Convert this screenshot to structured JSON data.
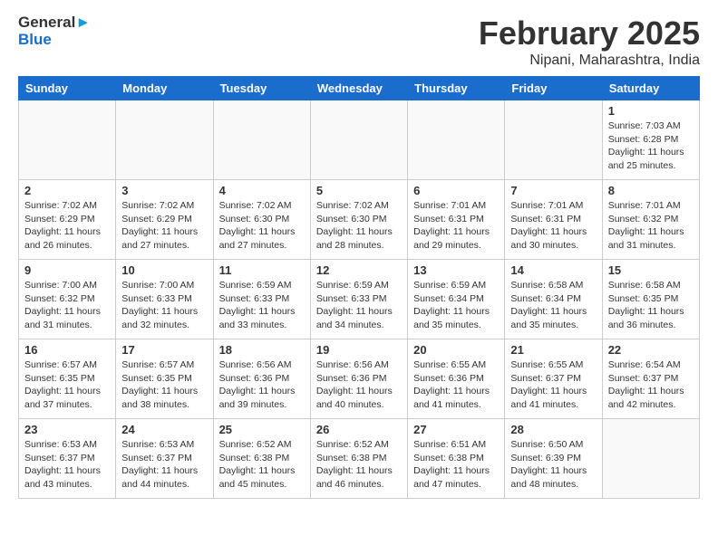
{
  "header": {
    "logo_line1": "General",
    "logo_line2": "Blue",
    "month_title": "February 2025",
    "location": "Nipani, Maharashtra, India"
  },
  "weekdays": [
    "Sunday",
    "Monday",
    "Tuesday",
    "Wednesday",
    "Thursday",
    "Friday",
    "Saturday"
  ],
  "weeks": [
    [
      {
        "day": "",
        "info": ""
      },
      {
        "day": "",
        "info": ""
      },
      {
        "day": "",
        "info": ""
      },
      {
        "day": "",
        "info": ""
      },
      {
        "day": "",
        "info": ""
      },
      {
        "day": "",
        "info": ""
      },
      {
        "day": "1",
        "info": "Sunrise: 7:03 AM\nSunset: 6:28 PM\nDaylight: 11 hours and 25 minutes."
      }
    ],
    [
      {
        "day": "2",
        "info": "Sunrise: 7:02 AM\nSunset: 6:29 PM\nDaylight: 11 hours and 26 minutes."
      },
      {
        "day": "3",
        "info": "Sunrise: 7:02 AM\nSunset: 6:29 PM\nDaylight: 11 hours and 27 minutes."
      },
      {
        "day": "4",
        "info": "Sunrise: 7:02 AM\nSunset: 6:30 PM\nDaylight: 11 hours and 27 minutes."
      },
      {
        "day": "5",
        "info": "Sunrise: 7:02 AM\nSunset: 6:30 PM\nDaylight: 11 hours and 28 minutes."
      },
      {
        "day": "6",
        "info": "Sunrise: 7:01 AM\nSunset: 6:31 PM\nDaylight: 11 hours and 29 minutes."
      },
      {
        "day": "7",
        "info": "Sunrise: 7:01 AM\nSunset: 6:31 PM\nDaylight: 11 hours and 30 minutes."
      },
      {
        "day": "8",
        "info": "Sunrise: 7:01 AM\nSunset: 6:32 PM\nDaylight: 11 hours and 31 minutes."
      }
    ],
    [
      {
        "day": "9",
        "info": "Sunrise: 7:00 AM\nSunset: 6:32 PM\nDaylight: 11 hours and 31 minutes."
      },
      {
        "day": "10",
        "info": "Sunrise: 7:00 AM\nSunset: 6:33 PM\nDaylight: 11 hours and 32 minutes."
      },
      {
        "day": "11",
        "info": "Sunrise: 6:59 AM\nSunset: 6:33 PM\nDaylight: 11 hours and 33 minutes."
      },
      {
        "day": "12",
        "info": "Sunrise: 6:59 AM\nSunset: 6:33 PM\nDaylight: 11 hours and 34 minutes."
      },
      {
        "day": "13",
        "info": "Sunrise: 6:59 AM\nSunset: 6:34 PM\nDaylight: 11 hours and 35 minutes."
      },
      {
        "day": "14",
        "info": "Sunrise: 6:58 AM\nSunset: 6:34 PM\nDaylight: 11 hours and 35 minutes."
      },
      {
        "day": "15",
        "info": "Sunrise: 6:58 AM\nSunset: 6:35 PM\nDaylight: 11 hours and 36 minutes."
      }
    ],
    [
      {
        "day": "16",
        "info": "Sunrise: 6:57 AM\nSunset: 6:35 PM\nDaylight: 11 hours and 37 minutes."
      },
      {
        "day": "17",
        "info": "Sunrise: 6:57 AM\nSunset: 6:35 PM\nDaylight: 11 hours and 38 minutes."
      },
      {
        "day": "18",
        "info": "Sunrise: 6:56 AM\nSunset: 6:36 PM\nDaylight: 11 hours and 39 minutes."
      },
      {
        "day": "19",
        "info": "Sunrise: 6:56 AM\nSunset: 6:36 PM\nDaylight: 11 hours and 40 minutes."
      },
      {
        "day": "20",
        "info": "Sunrise: 6:55 AM\nSunset: 6:36 PM\nDaylight: 11 hours and 41 minutes."
      },
      {
        "day": "21",
        "info": "Sunrise: 6:55 AM\nSunset: 6:37 PM\nDaylight: 11 hours and 41 minutes."
      },
      {
        "day": "22",
        "info": "Sunrise: 6:54 AM\nSunset: 6:37 PM\nDaylight: 11 hours and 42 minutes."
      }
    ],
    [
      {
        "day": "23",
        "info": "Sunrise: 6:53 AM\nSunset: 6:37 PM\nDaylight: 11 hours and 43 minutes."
      },
      {
        "day": "24",
        "info": "Sunrise: 6:53 AM\nSunset: 6:37 PM\nDaylight: 11 hours and 44 minutes."
      },
      {
        "day": "25",
        "info": "Sunrise: 6:52 AM\nSunset: 6:38 PM\nDaylight: 11 hours and 45 minutes."
      },
      {
        "day": "26",
        "info": "Sunrise: 6:52 AM\nSunset: 6:38 PM\nDaylight: 11 hours and 46 minutes."
      },
      {
        "day": "27",
        "info": "Sunrise: 6:51 AM\nSunset: 6:38 PM\nDaylight: 11 hours and 47 minutes."
      },
      {
        "day": "28",
        "info": "Sunrise: 6:50 AM\nSunset: 6:39 PM\nDaylight: 11 hours and 48 minutes."
      },
      {
        "day": "",
        "info": ""
      }
    ]
  ]
}
